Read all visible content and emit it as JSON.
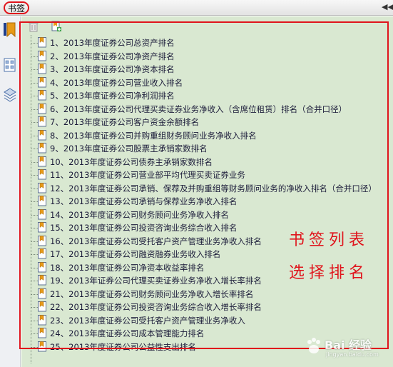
{
  "panel": {
    "title": "书签",
    "collapse_icon": "double-left-arrow-icon"
  },
  "sidebar": {
    "icons": [
      "bookmarks-panel-icon",
      "page-thumbnails-icon",
      "layers-icon"
    ]
  },
  "toolbar": {
    "buttons": [
      "delete-bookmark-icon",
      "new-bookmark-icon"
    ]
  },
  "bookmarks": [
    "1、2013年度证券公司总资产排名",
    "2、2013年度证券公司净资产排名",
    "3、2013年度证券公司净资本排名",
    "4、2013年度证券公司营业收入排名",
    "5、2013年度证券公司净利润排名",
    "6、2013年度证券公司代理买卖证券业务净收入（含席位租赁）排名（合并口径）",
    "7、2013年度证券公司客户资金余额排名",
    "8、2013年度证券公司并购重组财务顾问业务净收入排名",
    "9、2013年度证券公司股票主承销家数排名",
    "10、2013年度证券公司债券主承销家数排名",
    "11、2013年度证券公司营业部平均代理买卖证券业务",
    "12、2013年度证券公司承销、保荐及并购重组等财务顾问业务的净收入排名（合并口径）",
    "13、2013年度证券公司承销与保荐业务净收入排名",
    "14、2013年度证券公司财务顾问业务净收入排名",
    "15、2013年度证券公司投资咨询业务综合收入排名",
    "16、2013年度证券公司受托客户资产管理业务净收入排名",
    "17、2013年度证券公司融资融券业务收入排名",
    "18、2013年度证券公司净资本收益率排名",
    "19、2013年证券公司代理买卖证券业务净收入增长率排名",
    "21、2013年度证券公司财务顾问业务净收入增长率排名",
    "22、2013年度证券公司投资咨询业务综合收入增长率排名",
    "23、2013年度证券公司受托客户资产管理业务净收入",
    "24、2013年度证券公司成本管理能力排名",
    "25、2013年度证券公司公益性支出排名"
  ],
  "annotation": {
    "line1": "书签列表",
    "line2": "选择排名"
  },
  "watermark": {
    "text": "Bai 经验",
    "sub": "jingyan.baidu.com"
  },
  "colors": {
    "panel_bg": "#d9e8d1",
    "highlight": "#e0141c",
    "text": "#1c1c3a"
  }
}
